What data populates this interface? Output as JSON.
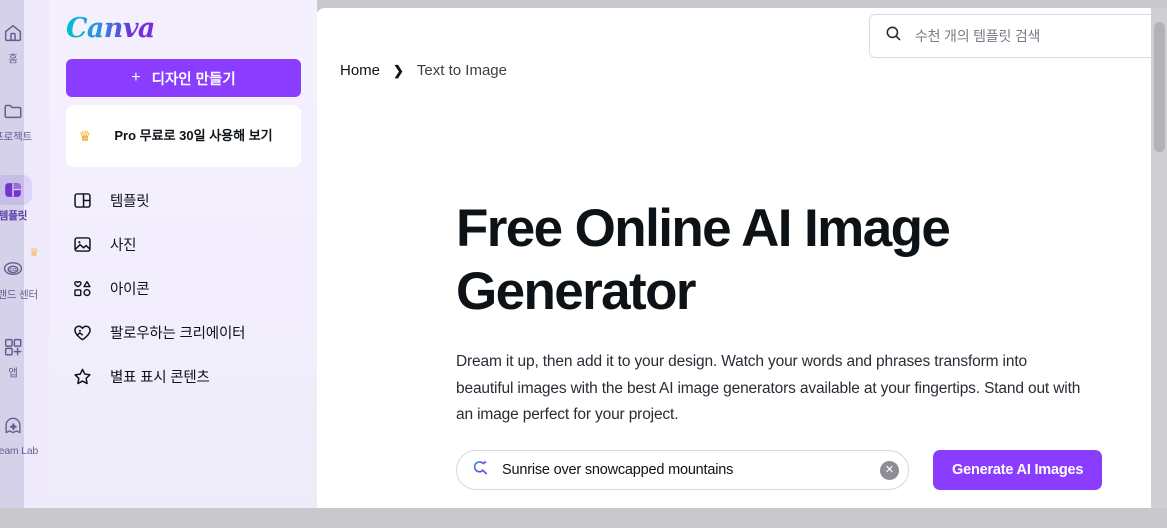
{
  "colors": {
    "brand_purple": "#8B3DFF",
    "sidebar_bg": "#F2EEFD",
    "rail_active": "#DDD3FB",
    "page_chrome": "#C9C9CD",
    "crown_gold": "#F5A623",
    "logo_gradient_from": "#00C4CC",
    "logo_gradient_to": "#7D2AE8"
  },
  "rail": {
    "items": [
      {
        "label": "홈",
        "icon": "home-icon",
        "active": false,
        "pro": false
      },
      {
        "label": "프로젝트",
        "icon": "folder-icon",
        "active": false,
        "pro": false
      },
      {
        "label": "템플릿",
        "icon": "templates-icon",
        "active": true,
        "pro": false
      },
      {
        "label": "브랜드 센터",
        "icon": "brand-center-icon",
        "active": false,
        "pro": true
      },
      {
        "label": "앱",
        "icon": "apps-icon",
        "active": false,
        "pro": false
      },
      {
        "label": "Dream Lab",
        "icon": "dream-lab-icon",
        "active": false,
        "pro": false
      }
    ]
  },
  "sidebar": {
    "logo_text": "Canva",
    "create_button": {
      "label": "디자인 만들기",
      "plus": "+"
    },
    "pro_card": {
      "label": "Pro 무료로 30일 사용해 보기",
      "crown": "♛"
    },
    "nav_items": [
      {
        "label": "템플릿",
        "icon": "template-panel-icon"
      },
      {
        "label": "사진",
        "icon": "photo-icon"
      },
      {
        "label": "아이콘",
        "icon": "shapes-icon"
      },
      {
        "label": "팔로우하는 크리에이터",
        "icon": "heart-image-icon"
      },
      {
        "label": "별표 표시 콘텐츠",
        "icon": "star-icon"
      }
    ]
  },
  "search": {
    "placeholder": "수천 개의 템플릿 검색",
    "icon": "search-icon"
  },
  "breadcrumb": {
    "home": "Home",
    "separator": "❯",
    "current": "Text to Image"
  },
  "hero": {
    "title": "Free Online AI Image Generator",
    "body": "Dream it up, then add it to your design. Watch your words and phrases transform into beautiful images with the best AI image generators available at your fingertips. Stand out with an image perfect for your project."
  },
  "prompt": {
    "icon": "magic-search-icon",
    "value": "Sunrise over snowcapped mountains",
    "clear_label": "✕",
    "generate_button": "Generate AI Images"
  }
}
